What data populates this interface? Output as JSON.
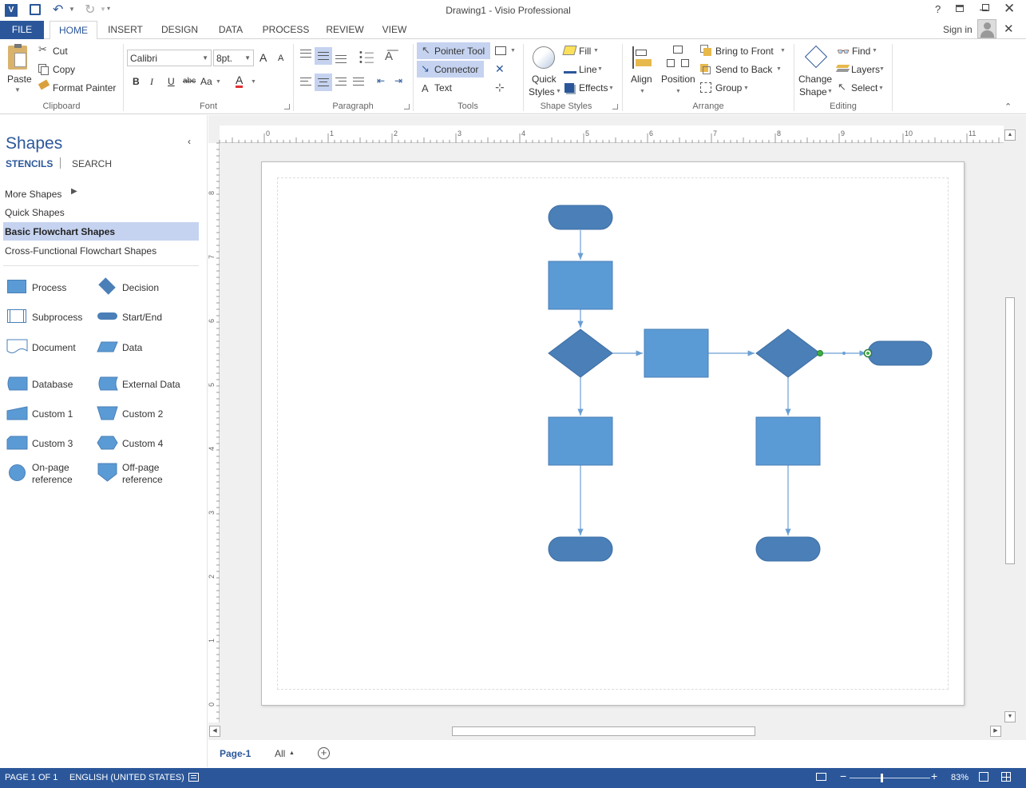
{
  "window": {
    "title": "Drawing1 - Visio Professional",
    "sign_in": "Sign in"
  },
  "tabs": [
    "FILE",
    "HOME",
    "INSERT",
    "DESIGN",
    "DATA",
    "PROCESS",
    "REVIEW",
    "VIEW"
  ],
  "active_tab": "HOME",
  "ribbon": {
    "clipboard": {
      "paste": "Paste",
      "cut": "Cut",
      "copy": "Copy",
      "format_painter": "Format Painter",
      "label": "Clipboard"
    },
    "font": {
      "family": "Calibri",
      "size": "8pt.",
      "bold": "B",
      "italic": "I",
      "underline": "U",
      "strike": "abc",
      "case": "Aa",
      "grow": "A",
      "shrink": "A",
      "color": "A",
      "label": "Font"
    },
    "paragraph": {
      "label": "Paragraph"
    },
    "tools": {
      "pointer": "Pointer Tool",
      "connector": "Connector",
      "text": "Text",
      "label": "Tools"
    },
    "shape_styles": {
      "quick_styles_1": "Quick",
      "quick_styles_2": "Styles",
      "fill": "Fill",
      "line": "Line",
      "effects": "Effects",
      "label": "Shape Styles"
    },
    "arrange": {
      "align": "Align",
      "position": "Position",
      "bring_front": "Bring to Front",
      "send_back": "Send to Back",
      "group": "Group",
      "label": "Arrange"
    },
    "editing": {
      "change_shape_1": "Change",
      "change_shape_2": "Shape",
      "find": "Find",
      "layers": "Layers",
      "select": "Select",
      "label": "Editing"
    }
  },
  "shapes_pane": {
    "title": "Shapes",
    "tab_stencils": "STENCILS",
    "tab_search": "SEARCH",
    "nav": [
      "More Shapes",
      "Quick Shapes",
      "Basic Flowchart Shapes",
      "Cross-Functional Flowchart Shapes"
    ],
    "selected_nav": "Basic Flowchart Shapes",
    "items": [
      {
        "label": "Process",
        "icon": "process-shape-icon"
      },
      {
        "label": "Decision",
        "icon": "decision-shape-icon"
      },
      {
        "label": "Subprocess",
        "icon": "subprocess-shape-icon"
      },
      {
        "label": "Start/End",
        "icon": "start-end-shape-icon"
      },
      {
        "label": "Document",
        "icon": "document-shape-icon"
      },
      {
        "label": "Data",
        "icon": "data-shape-icon"
      },
      {
        "label": "Database",
        "icon": "database-shape-icon"
      },
      {
        "label": "External Data",
        "icon": "external-data-shape-icon"
      },
      {
        "label": "Custom 1",
        "icon": "custom1-shape-icon"
      },
      {
        "label": "Custom 2",
        "icon": "custom2-shape-icon"
      },
      {
        "label": "Custom 3",
        "icon": "custom3-shape-icon"
      },
      {
        "label": "Custom 4",
        "icon": "custom4-shape-icon"
      },
      {
        "label": "On-page reference",
        "label_1": "On-page",
        "label_2": "reference",
        "icon": "on-page-reference-icon"
      },
      {
        "label": "Off-page reference",
        "label_1": "Off-page",
        "label_2": "reference",
        "icon": "off-page-reference-icon"
      }
    ]
  },
  "rulers": {
    "horizontal": [
      "0",
      "1",
      "2",
      "3",
      "4",
      "5",
      "6",
      "7",
      "8",
      "9",
      "10",
      "11"
    ],
    "vertical": [
      "8",
      "7",
      "6",
      "5",
      "4",
      "3",
      "2",
      "1",
      "0"
    ]
  },
  "page_tabs": {
    "current": "Page-1",
    "all": "All"
  },
  "status": {
    "page": "PAGE 1 OF 1",
    "language": "ENGLISH (UNITED STATES)",
    "zoom": "83%"
  },
  "colors": {
    "accent": "#2b579a",
    "shape_fill": "#5b9bd5",
    "shape_dark": "#4a7fb8",
    "connector": "#6a9fd4",
    "selected_nav": "#c5d3f0"
  }
}
